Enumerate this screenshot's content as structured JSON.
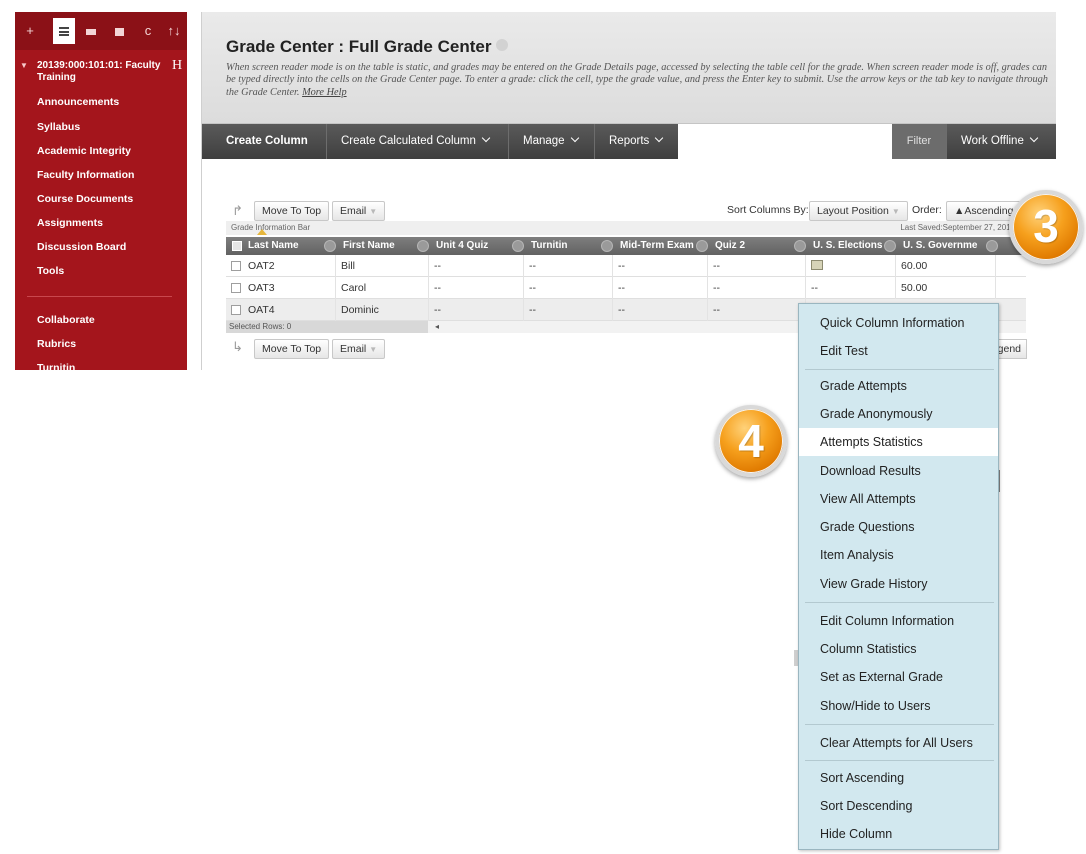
{
  "sidebar": {
    "toolbar_icons": [
      "plus-icon",
      "list-icon",
      "folder-icon",
      "window-icon",
      "refresh-icon",
      "sort-icon"
    ],
    "toolbar_glyphs": {
      "plus": "+",
      "refresh": "c",
      "sort": "↑↓"
    },
    "course_title": "20139:000:101:01: Faculty Training",
    "course_h": "H",
    "nav": [
      "Announcements",
      "Syllabus",
      "Academic Integrity",
      "Faculty Information",
      "Course Documents",
      "Assignments",
      "Discussion Board",
      "Tools",
      "Collaborate",
      "Rubrics",
      "Turnitin"
    ]
  },
  "header": {
    "title": "Grade Center : Full Grade Center",
    "description": "When screen reader mode is on the table is static, and grades may be entered on the Grade Details page, accessed by selecting the table cell for the grade. When screen reader mode is off, grades can be typed directly into the cells on the Grade Center page. To enter a grade: click the cell, type the grade value, and press the Enter key to submit. Use the arrow keys or the tab key to navigate through the Grade Center.",
    "more_help": "More Help"
  },
  "menubar": {
    "create_column": "Create Column",
    "create_calculated": "Create Calculated Column",
    "manage": "Manage",
    "reports": "Reports",
    "filter": "Filter",
    "work_offline": "Work Offline"
  },
  "toolbar": {
    "move_to_top": "Move To Top",
    "email": "Email",
    "sort_columns_by": "Sort Columns By:",
    "layout_position": "Layout Position",
    "order": "Order:",
    "ascending": "▲Ascending"
  },
  "grid": {
    "info_bar": "Grade Information Bar",
    "last_saved": "Last Saved:September 27, 2013 1:",
    "columns": [
      "Last Name",
      "First Name",
      "Unit 4 Quiz",
      "Turnitin",
      "Mid-Term Exam",
      "Quiz 2",
      "U. S. Elections",
      "U. S. Governme"
    ],
    "rows": [
      {
        "last": "OAT2",
        "first": "Bill",
        "c1": "--",
        "c2": "--",
        "c3": "--",
        "c4": "--",
        "c5": "",
        "c6": "60.00"
      },
      {
        "last": "OAT3",
        "first": "Carol",
        "c1": "--",
        "c2": "--",
        "c3": "--",
        "c4": "--",
        "c5": "--",
        "c6": "50.00"
      },
      {
        "last": "OAT4",
        "first": "Dominic",
        "c1": "--",
        "c2": "--",
        "c3": "--",
        "c4": "--",
        "c5": "",
        "c6": ""
      }
    ],
    "selected_rows": "Selected Rows: 0",
    "legend_partial": "gend"
  },
  "context_menu": {
    "items": [
      "Quick Column Information",
      "Edit Test",
      "Grade Attempts",
      "Grade Anonymously",
      "Attempts Statistics",
      "Download Results",
      "View All Attempts",
      "Grade Questions",
      "Item Analysis",
      "View Grade History",
      "Edit Column Information",
      "Column Statistics",
      "Set as External Grade",
      "Show/Hide to Users",
      "Clear Attempts for All Users",
      "Sort Ascending",
      "Sort Descending",
      "Hide Column"
    ],
    "highlighted": "Attempts Statistics"
  },
  "callouts": {
    "step3": "3",
    "step4": "4"
  },
  "colors": {
    "sidebar_bg": "#a4151c",
    "menubar_bg": "#4a4a4a",
    "context_menu_bg": "#d2e8ef",
    "badge_orange": "#f6a01d"
  }
}
